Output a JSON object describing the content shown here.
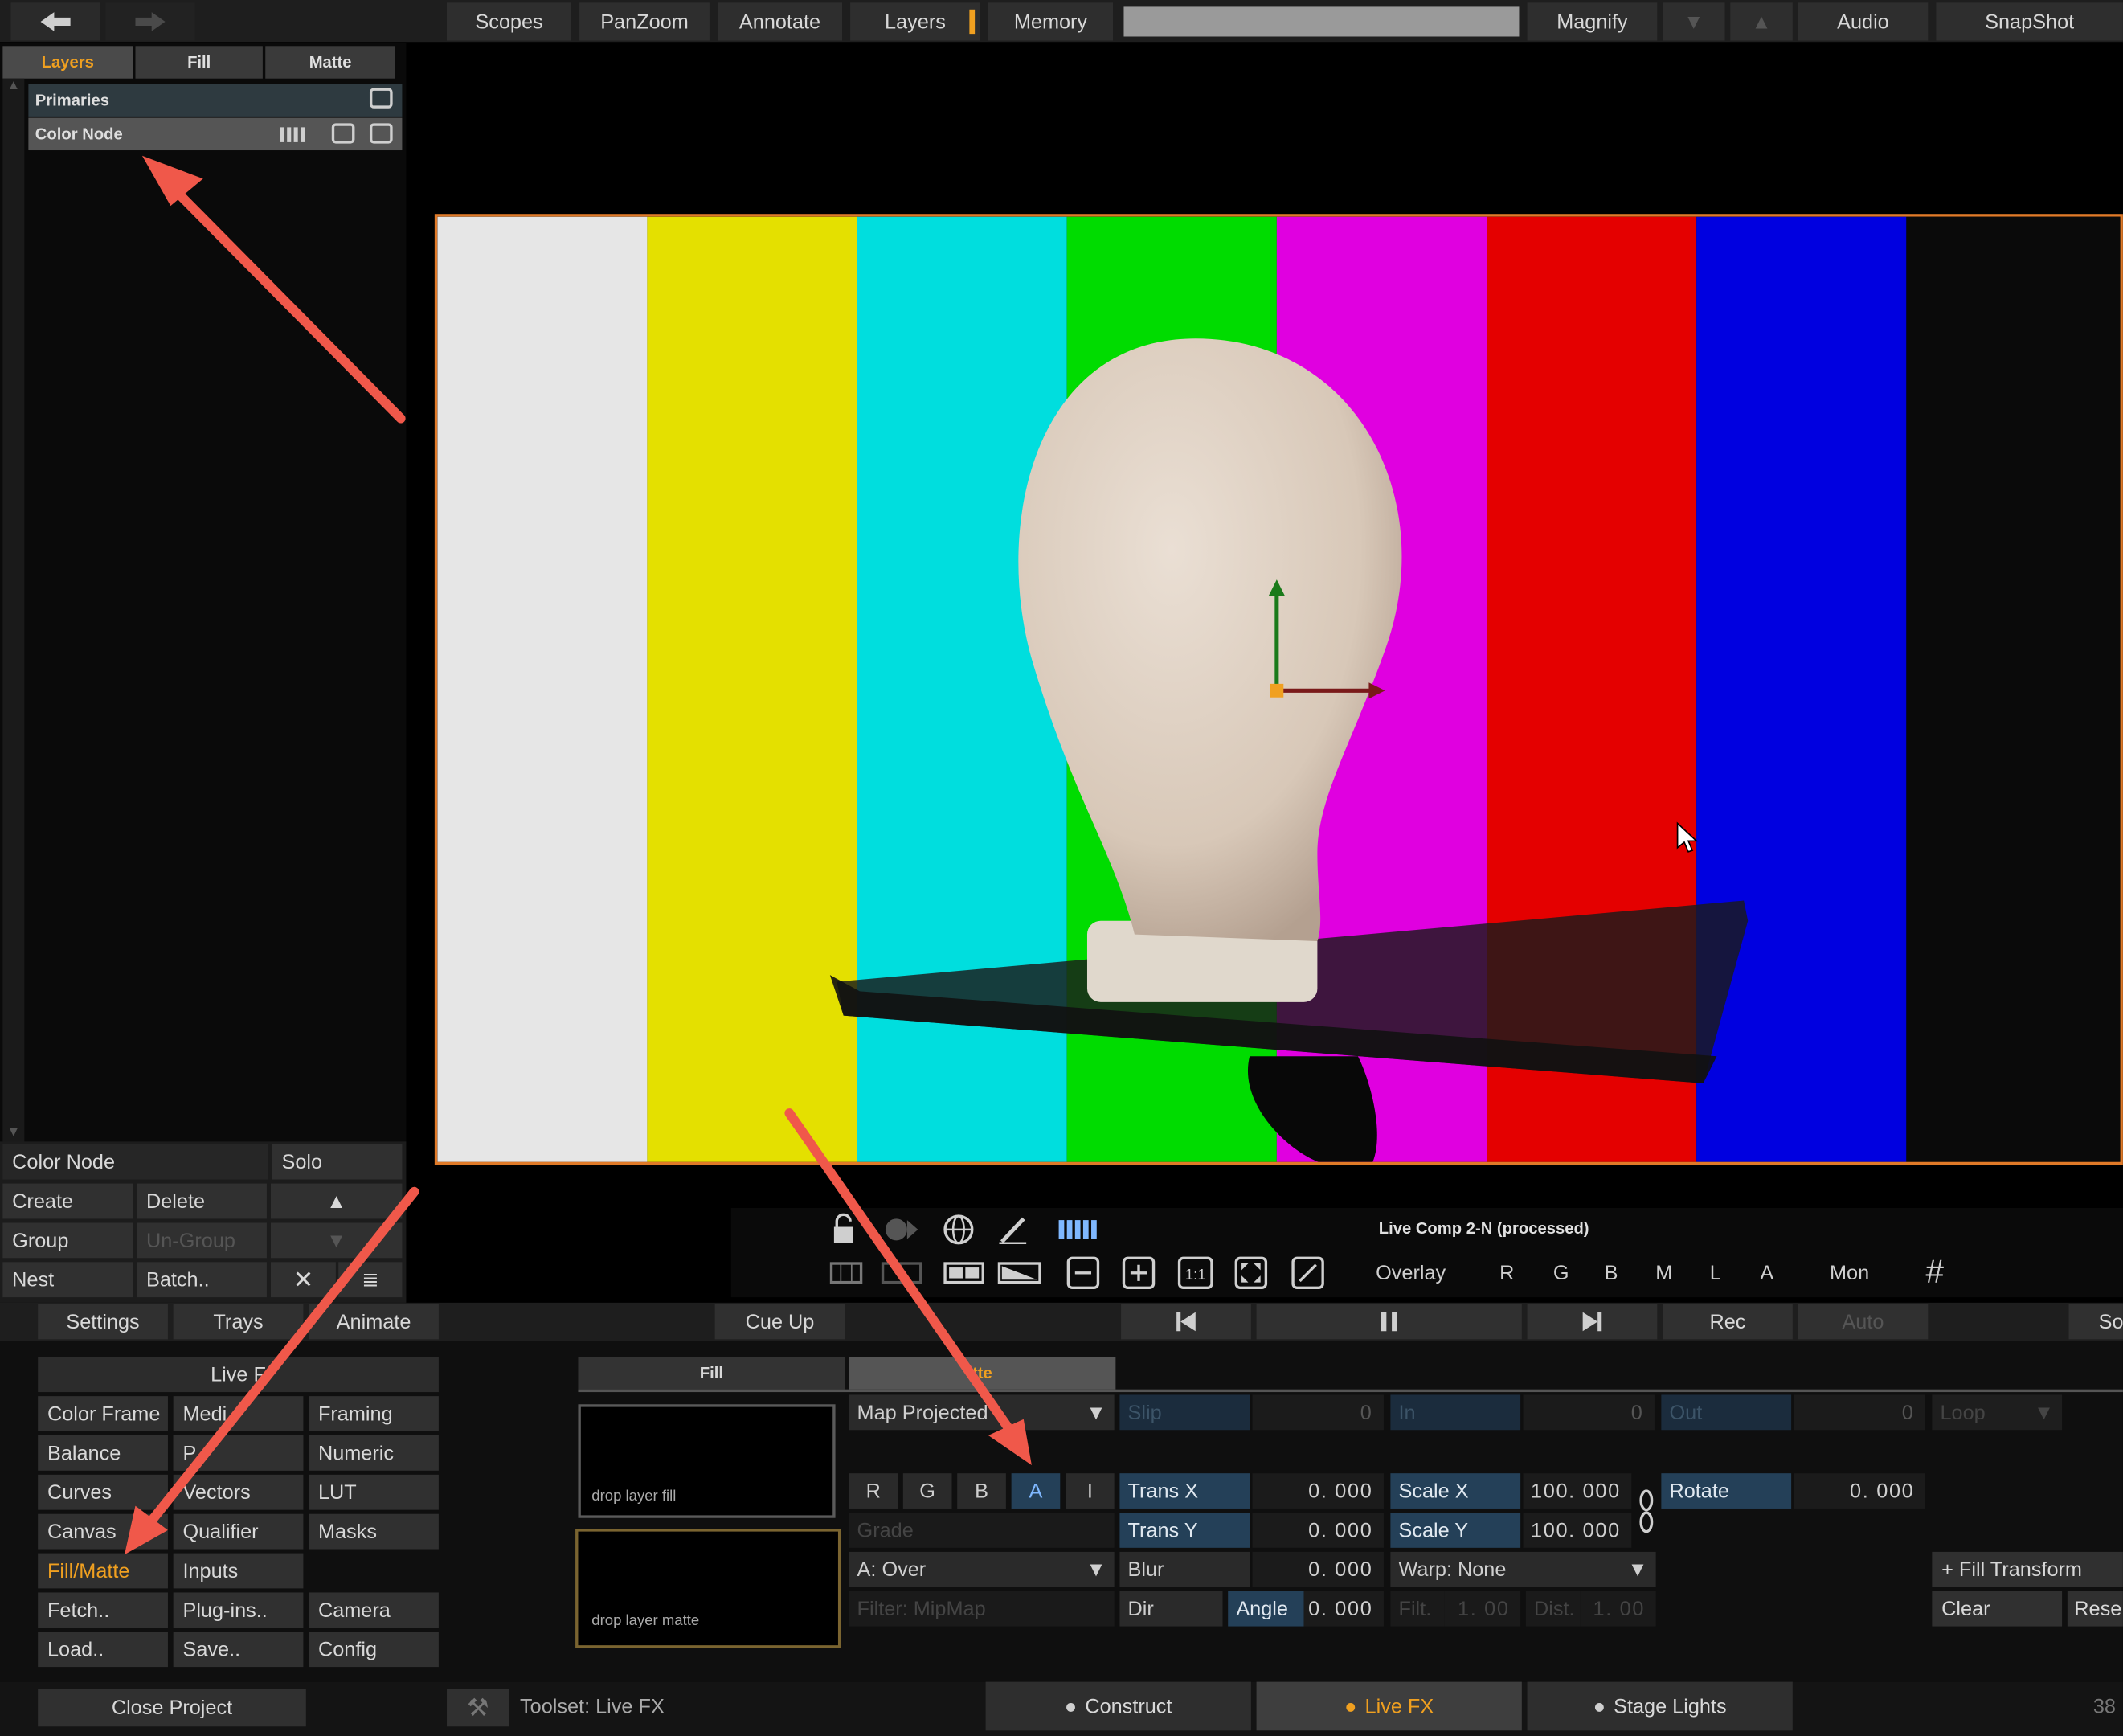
{
  "topbar": {
    "scopes": "Scopes",
    "panzoom": "PanZoom",
    "annotate": "Annotate",
    "layers": "Layers",
    "memory": "Memory",
    "magnify": "Magnify",
    "audio": "Audio",
    "snapshot": "SnapShot"
  },
  "left_tabs": [
    "Layers",
    "Fill",
    "Matte"
  ],
  "layers": [
    {
      "name": "Primaries"
    },
    {
      "name": "Color Node"
    }
  ],
  "left_controls": {
    "node_name": "Color Node",
    "solo": "Solo",
    "create": "Create",
    "delete": "Delete",
    "group": "Group",
    "ungroup": "Un-Group",
    "nest": "Nest",
    "batch": "Batch.."
  },
  "viewer": {
    "title": "Live Comp 2-N (processed)",
    "overlay": "Overlay",
    "channels": [
      "R",
      "G",
      "B",
      "M",
      "L",
      "A"
    ],
    "mon": "Mon",
    "one_to_one": "1:1"
  },
  "bottom_bar": {
    "settings": "Settings",
    "trays": "Trays",
    "animate": "Animate",
    "cue_up": "Cue Up",
    "rec": "Rec",
    "auto": "Auto",
    "cut_label": "So"
  },
  "tools": {
    "header": "Live F",
    "items": [
      "Color Frame",
      "Medi",
      "Framing",
      "Balance",
      "P",
      "mary",
      "Numeric",
      "Curves",
      "Vectors",
      "LUT",
      "Canvas",
      "Qualifier",
      "Masks",
      "Fill/Matte",
      "Inputs",
      "Fetch..",
      "Plug-ins..",
      "Camera",
      "Load..",
      "Save..",
      "Config"
    ]
  },
  "fillmatte": {
    "fill_tab": "Fill",
    "matte_tab": "tte",
    "drop_fill": "drop layer fill",
    "drop_matte": "drop layer matte",
    "map_select": "Map Projected",
    "rgb": [
      "R",
      "G",
      "B",
      "A",
      "I"
    ],
    "grade": "Grade",
    "blend": "A: Over",
    "filter": "Filter: MipMap"
  },
  "timing": {
    "slip_label": "Slip",
    "slip": "0",
    "in_label": "In",
    "in": "0",
    "out_label": "Out",
    "out": "0",
    "loop": "Loop"
  },
  "transform": {
    "trans_x_label": "Trans X",
    "trans_x": "0. 000",
    "trans_y_label": "Trans Y",
    "trans_y": "0. 000",
    "scale_x_label": "Scale X",
    "scale_x": "100. 000",
    "scale_y_label": "Scale Y",
    "scale_y": "100. 000",
    "rotate_label": "Rotate",
    "rotate": "0. 000",
    "blur_label": "Blur",
    "blur": "0. 000",
    "dir_label": "Dir",
    "angle_label": "Angle",
    "angle": "0. 000",
    "warp": "Warp: None",
    "filt_label": "Filt.",
    "filt": "1. 00",
    "dist_label": "Dist.",
    "dist": "1. 00",
    "fill_transform": "+ Fill Transform",
    "clear": "Clear",
    "reset": "Rese"
  },
  "status": {
    "close_project": "Close Project",
    "toolset": "Toolset: Live FX",
    "construct": "Construct",
    "live_fx": "Live FX",
    "stage_lights": "Stage Lights",
    "frame": "38"
  },
  "colors": {
    "accent": "#f0a020",
    "selected_tab": "#3a3a3a",
    "bar_colors": [
      "#e6e6e6",
      "#e4e000",
      "#00dede",
      "#00dc00",
      "#e000e0",
      "#e40000",
      "#0000e0",
      "#0a0a0a"
    ]
  }
}
